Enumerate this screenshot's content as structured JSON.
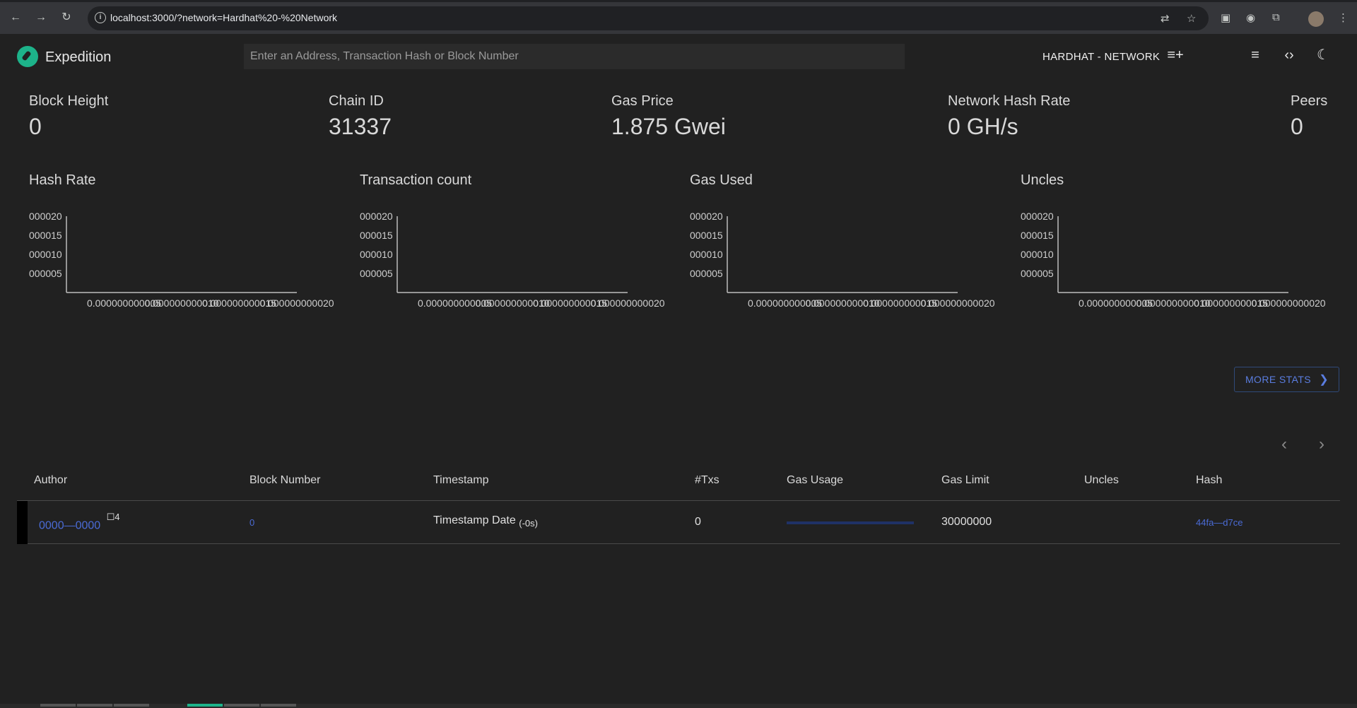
{
  "browser": {
    "url": "localhost:3000/?network=Hardhat%20-%20Network",
    "info_icon": "site-info-icon"
  },
  "app": {
    "title": "Expedition",
    "search_placeholder": "Enter an Address, Transaction Hash or Block Number",
    "network": "HARDHAT - NETWORK",
    "accent_color": "#1db38a"
  },
  "stats": [
    {
      "label": "Block Height",
      "value": "0"
    },
    {
      "label": "Chain ID",
      "value": "31337"
    },
    {
      "label": "Gas Price",
      "value": "1.875 Gwei"
    },
    {
      "label": "Network Hash Rate",
      "value": "0 GH/s"
    },
    {
      "label": "Peers",
      "value": "0"
    }
  ],
  "charts": [
    {
      "title": "Hash Rate"
    },
    {
      "title": "Transaction count"
    },
    {
      "title": "Gas Used"
    },
    {
      "title": "Uncles"
    }
  ],
  "chart_data": [
    {
      "type": "line",
      "title": "Hash Rate",
      "series": [],
      "y_ticks": [
        "000005",
        "000010",
        "000015",
        "000020"
      ],
      "x_ticks": [
        "0.000000000005",
        "0.000000000010",
        "0.000000000015",
        "0.000000000020"
      ],
      "y_tick_values": [
        5e-12,
        1e-11,
        1.5e-11,
        2e-11
      ],
      "ylim": [
        0,
        2e-11
      ],
      "xlim": [
        0,
        2e-11
      ]
    },
    {
      "type": "line",
      "title": "Transaction count",
      "series": [],
      "y_ticks": [
        "000005",
        "000010",
        "000015",
        "000020"
      ],
      "x_ticks": [
        "0.000000000005",
        "0.000000000010",
        "0.000000000015",
        "0.000000000020"
      ],
      "y_tick_values": [
        5e-12,
        1e-11,
        1.5e-11,
        2e-11
      ],
      "ylim": [
        0,
        2e-11
      ],
      "xlim": [
        0,
        2e-11
      ]
    },
    {
      "type": "line",
      "title": "Gas Used",
      "series": [],
      "y_ticks": [
        "000005",
        "000010",
        "000015",
        "000020"
      ],
      "x_ticks": [
        "0.000000000005",
        "0.000000000010",
        "0.000000000015",
        "0.000000000020"
      ],
      "y_tick_values": [
        5e-12,
        1e-11,
        1.5e-11,
        2e-11
      ],
      "ylim": [
        0,
        2e-11
      ],
      "xlim": [
        0,
        2e-11
      ]
    },
    {
      "type": "line",
      "title": "Uncles",
      "series": [],
      "y_ticks": [
        "000005",
        "000010",
        "000015",
        "000020"
      ],
      "x_ticks": [
        "0.000000000005",
        "0.000000000010",
        "0.000000000015",
        "0.000000000020"
      ],
      "y_tick_values": [
        5e-12,
        1e-11,
        1.5e-11,
        2e-11
      ],
      "ylim": [
        0,
        2e-11
      ],
      "xlim": [
        0,
        2e-11
      ]
    }
  ],
  "more_stats": "MORE STATS",
  "table": {
    "headers": [
      "Author",
      "Block Number",
      "Timestamp",
      "#Txs",
      "Gas Usage",
      "Gas Limit",
      "Uncles",
      "Hash"
    ],
    "rows": [
      {
        "author": "0000—0000",
        "author_suffix": "4",
        "block_number": "0",
        "timestamp": "Timestamp Date",
        "timestamp_rel": "(-0s)",
        "txs": "0",
        "gas_usage_fraction": 0,
        "gas_limit": "30000000",
        "uncles": "",
        "hash": "44fa—d7ce"
      }
    ]
  }
}
